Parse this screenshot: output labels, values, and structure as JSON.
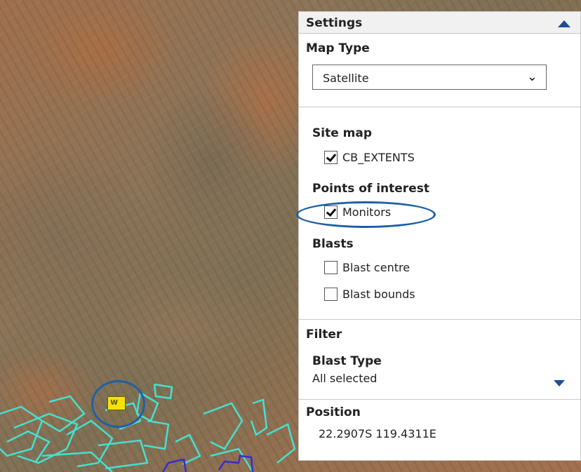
{
  "map": {
    "marker_icon": "monitor-marker-icon",
    "extents_color": "#45e0cf",
    "blast_color": "#3a2bd0"
  },
  "settings": {
    "title": "Settings",
    "collapse_icon": "triangle-up-icon",
    "map_type_label": "Map Type",
    "map_type_value": "Satellite",
    "site_map_label": "Site map",
    "site_map_item": "CB_EXTENTS",
    "poi_label": "Points of interest",
    "poi_item": "Monitors",
    "blasts_label": "Blasts",
    "blast_centre": "Blast centre",
    "blast_bounds": "Blast bounds"
  },
  "filter": {
    "title": "Filter",
    "blast_type_label": "Blast Type",
    "blast_type_value": "All selected",
    "expand_icon": "triangle-down-icon"
  },
  "position": {
    "label": "Position",
    "value": "22.2907S 119.4311E"
  },
  "checkboxes": {
    "cb_extents": true,
    "monitors": true,
    "blast_centre": false,
    "blast_bounds": false
  },
  "highlight_color": "#1f5fa8"
}
